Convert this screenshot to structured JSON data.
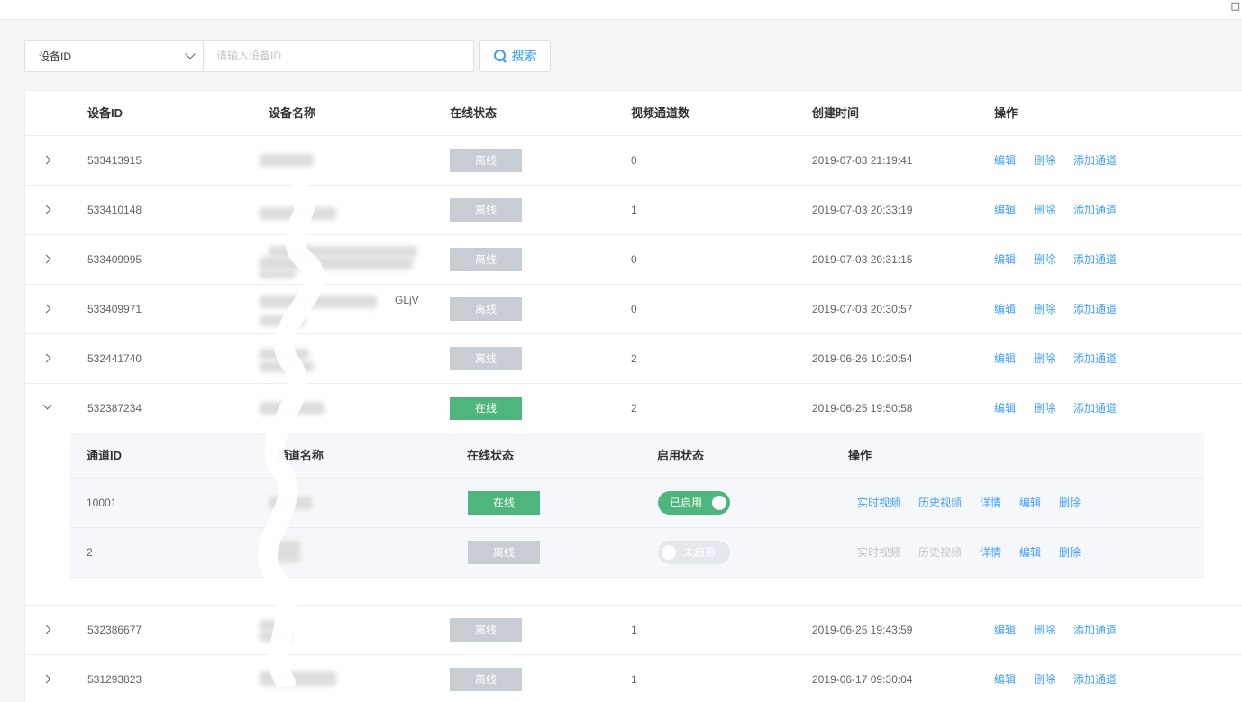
{
  "window": {
    "minimize_glyph": "–",
    "maximize_glyph": "□"
  },
  "search": {
    "field_select": "设备ID",
    "placeholder": "请输入设备ID",
    "button_label": "搜索"
  },
  "table": {
    "headers": [
      "设备ID",
      "设备名称",
      "在线状态",
      "视频通道数",
      "创建时间",
      "操作"
    ],
    "ops": {
      "edit": "编辑",
      "delete": "删除",
      "add_channel": "添加通道"
    },
    "rows_before": [
      {
        "id": "533413915",
        "status": "离线",
        "status_type": "offline",
        "channels": "0",
        "created": "2019-07-03 21:19:41"
      },
      {
        "id": "533410148",
        "status": "离线",
        "status_type": "offline",
        "channels": "1",
        "created": "2019-07-03 20:33:19"
      },
      {
        "id": "533409995",
        "status": "离线",
        "status_type": "offline",
        "channels": "0",
        "created": "2019-07-03 20:31:15"
      },
      {
        "id": "533409971",
        "name_fragment": "GLjV",
        "status": "离线",
        "status_type": "offline",
        "channels": "0",
        "created": "2019-07-03 20:30:57"
      },
      {
        "id": "532441740",
        "status": "离线",
        "status_type": "offline",
        "channels": "2",
        "created": "2019-06-26 10:20:54"
      },
      {
        "id": "532387234",
        "status": "在线",
        "status_type": "online",
        "channels": "2",
        "created": "2019-06-25 19:50:58",
        "expanded": true
      }
    ],
    "rows_after": [
      {
        "id": "532386677",
        "status": "离线",
        "status_type": "offline",
        "channels": "1",
        "created": "2019-06-25 19:43:59"
      },
      {
        "id": "531293823",
        "status": "离线",
        "status_type": "offline",
        "channels": "1",
        "created": "2019-06-17 09:30:04"
      }
    ]
  },
  "channels": {
    "headers": [
      "通道ID",
      "通道名称",
      "在线状态",
      "启用状态",
      "操作"
    ],
    "ops": {
      "live": "实时视频",
      "history": "历史视频",
      "detail": "详情",
      "edit": "编辑",
      "delete": "删除"
    },
    "rows": [
      {
        "id": "10001",
        "status": "在线",
        "status_type": "online",
        "enabled": "已启用",
        "enabled_on": true
      },
      {
        "id": "2",
        "status": "离线",
        "status_type": "offline",
        "enabled": "未启用",
        "enabled_on": false
      }
    ]
  },
  "colors": {
    "primary": "#409eff",
    "online": "#4eb67d",
    "offline": "#c8ccd3"
  }
}
